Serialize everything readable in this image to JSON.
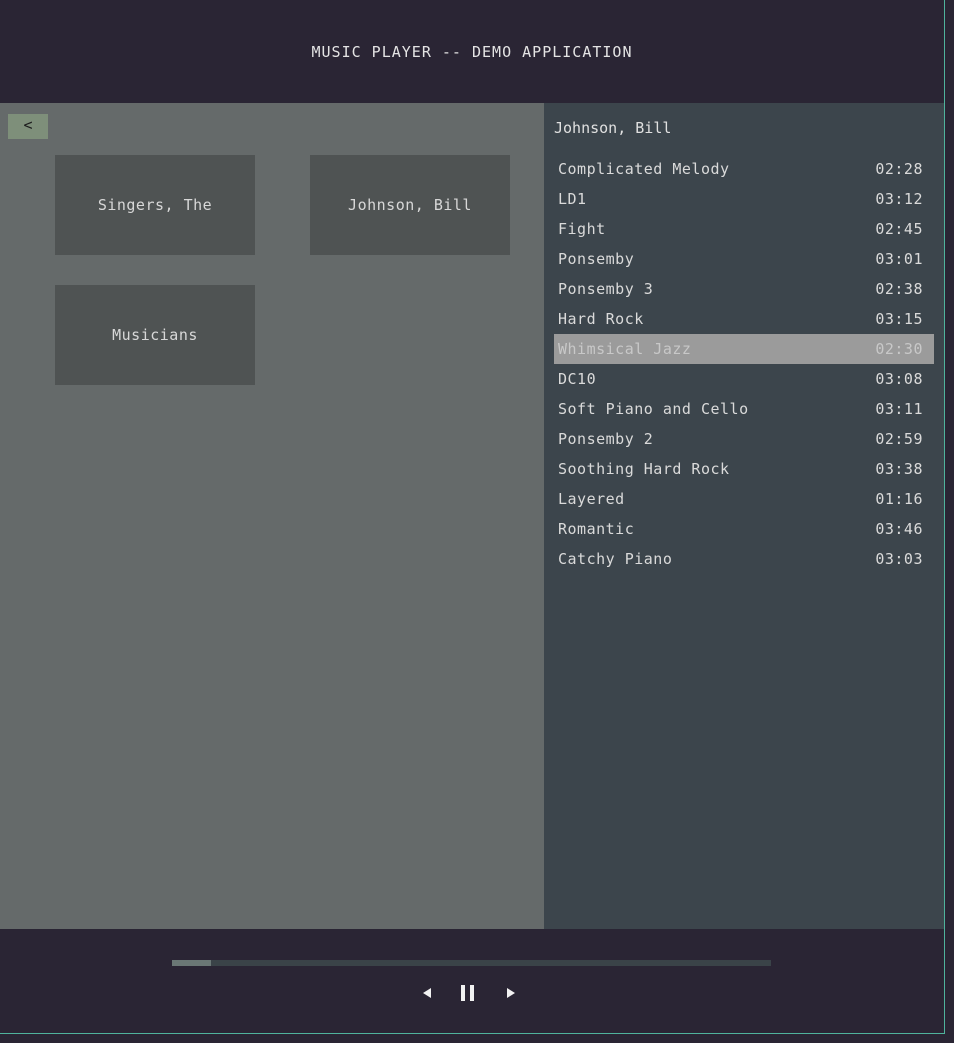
{
  "app": {
    "title": "MUSIC PLAYER -- DEMO APPLICATION"
  },
  "library": {
    "back_label": "<",
    "artists": [
      {
        "label": "Singers, The"
      },
      {
        "label": "Johnson, Bill"
      },
      {
        "label": "Musicians"
      }
    ]
  },
  "playlist": {
    "title": "Johnson, Bill",
    "selected_index": 6,
    "tracks": [
      {
        "name": "Complicated Melody",
        "duration": "02:28"
      },
      {
        "name": "LD1",
        "duration": "03:12"
      },
      {
        "name": "Fight",
        "duration": "02:45"
      },
      {
        "name": "Ponsemby",
        "duration": "03:01"
      },
      {
        "name": "Ponsemby 3",
        "duration": "02:38"
      },
      {
        "name": "Hard Rock",
        "duration": "03:15"
      },
      {
        "name": "Whimsical Jazz",
        "duration": "02:30"
      },
      {
        "name": "DC10",
        "duration": "03:08"
      },
      {
        "name": "Soft Piano and Cello",
        "duration": "03:11"
      },
      {
        "name": "Ponsemby 2",
        "duration": "02:59"
      },
      {
        "name": "Soothing Hard Rock",
        "duration": "03:38"
      },
      {
        "name": "Layered",
        "duration": "01:16"
      },
      {
        "name": "Romantic",
        "duration": "03:46"
      },
      {
        "name": "Catchy Piano",
        "duration": "03:03"
      }
    ]
  },
  "player": {
    "progress": 0.065,
    "controls": {
      "prev_icon": "previous-icon",
      "pause_icon": "pause-icon",
      "next_icon": "next-icon"
    }
  },
  "colors": {
    "background": "#2a2534",
    "library_panel": "#656a6a",
    "artist_tile": "#4f5353",
    "playlist_panel": "#3c454c",
    "selected_row": "#9b9b9b",
    "back_button": "#7e8f7a",
    "accent_border": "#4fb39c"
  }
}
